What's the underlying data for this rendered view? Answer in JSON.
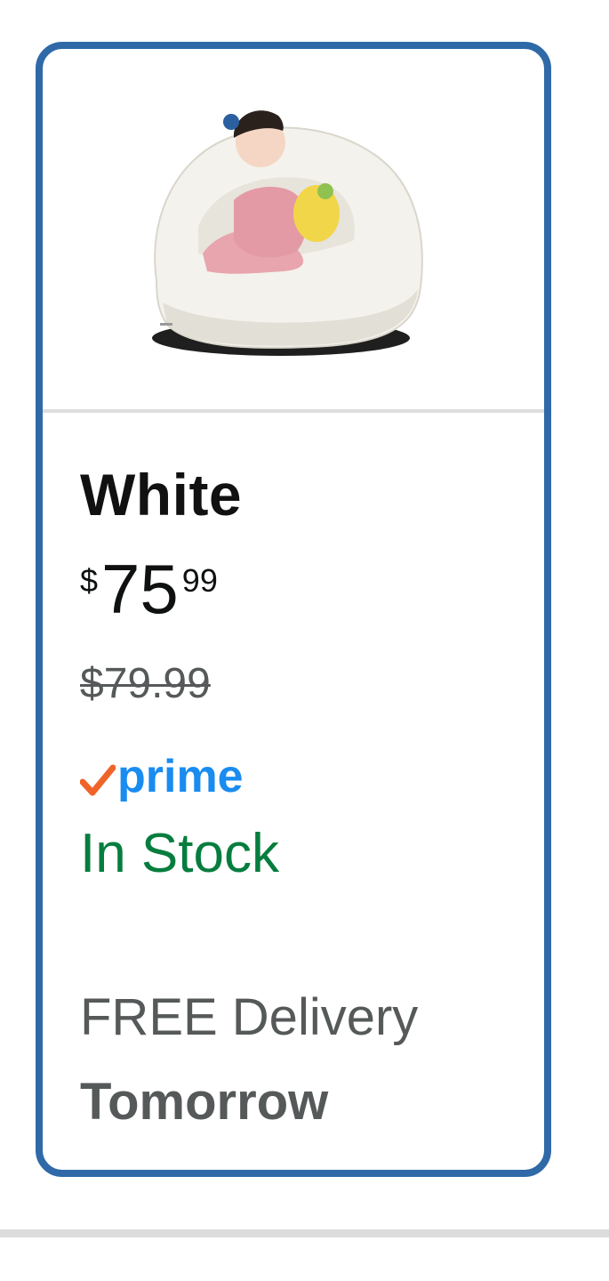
{
  "variant_card": {
    "image": {
      "name": "bean-bag-chair-product-image",
      "description_colors": {
        "chair": "#f2f0ea",
        "base": "#1f1f1f",
        "clothing": "#e8a5ad",
        "plush": "#f1d64a"
      }
    },
    "name": "White",
    "price": {
      "symbol": "$",
      "whole": "75",
      "fraction": "99"
    },
    "list_price": "$79.99",
    "prime": {
      "label": "prime",
      "icon": "check-icon"
    },
    "stock_status": "In Stock",
    "delivery": {
      "line": "FREE Delivery",
      "date": "Tomorrow"
    },
    "colors": {
      "selected_border": "#2f69a8",
      "price_text": "#0f1111",
      "list_price_text": "#565959",
      "prime_blue": "#1a8cf0",
      "prime_check": "#f0642a",
      "in_stock_green": "#067d3e",
      "delivery_text": "#565959"
    }
  }
}
